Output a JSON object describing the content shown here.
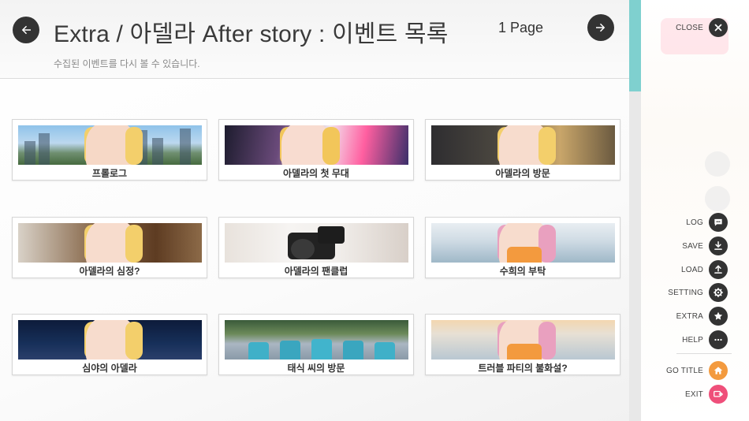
{
  "header": {
    "title": "Extra / 아델라 After story : 이벤트 목록",
    "page": "1 Page",
    "subtitle": "수집된 이벤트를 다시 볼 수 있습니다."
  },
  "events": [
    {
      "label": "프롤로그",
      "theme": "city"
    },
    {
      "label": "아델라의 첫 무대",
      "theme": "stage"
    },
    {
      "label": "아델라의 방문",
      "theme": "room"
    },
    {
      "label": "아델라의 심정?",
      "theme": "wood"
    },
    {
      "label": "아델라의 팬클럽",
      "theme": "camera"
    },
    {
      "label": "수희의 부탁",
      "theme": "store"
    },
    {
      "label": "심야의 아델라",
      "theme": "night"
    },
    {
      "label": "태식 씨의 방문",
      "theme": "terrace"
    },
    {
      "label": "트러블 파티의 불화설?",
      "theme": "store2"
    }
  ],
  "side_menu": {
    "close": {
      "label": "CLOSE",
      "icon": "close-icon"
    },
    "items": [
      {
        "label": "LOG",
        "icon": "chat-icon"
      },
      {
        "label": "SAVE",
        "icon": "download-icon"
      },
      {
        "label": "LOAD",
        "icon": "upload-icon"
      },
      {
        "label": "SETTING",
        "icon": "gear-icon"
      },
      {
        "label": "EXTRA",
        "icon": "star-icon"
      },
      {
        "label": "HELP",
        "icon": "more-icon"
      },
      {
        "label": "GO TITLE",
        "icon": "home-icon",
        "color": "#f39a3e"
      },
      {
        "label": "EXIT",
        "icon": "exit-icon",
        "color": "#ef4f7a"
      }
    ]
  },
  "colors": {
    "accent": "#7fd0cf",
    "dark_button": "#333333",
    "go_title": "#f39a3e",
    "exit": "#ef4f7a"
  }
}
